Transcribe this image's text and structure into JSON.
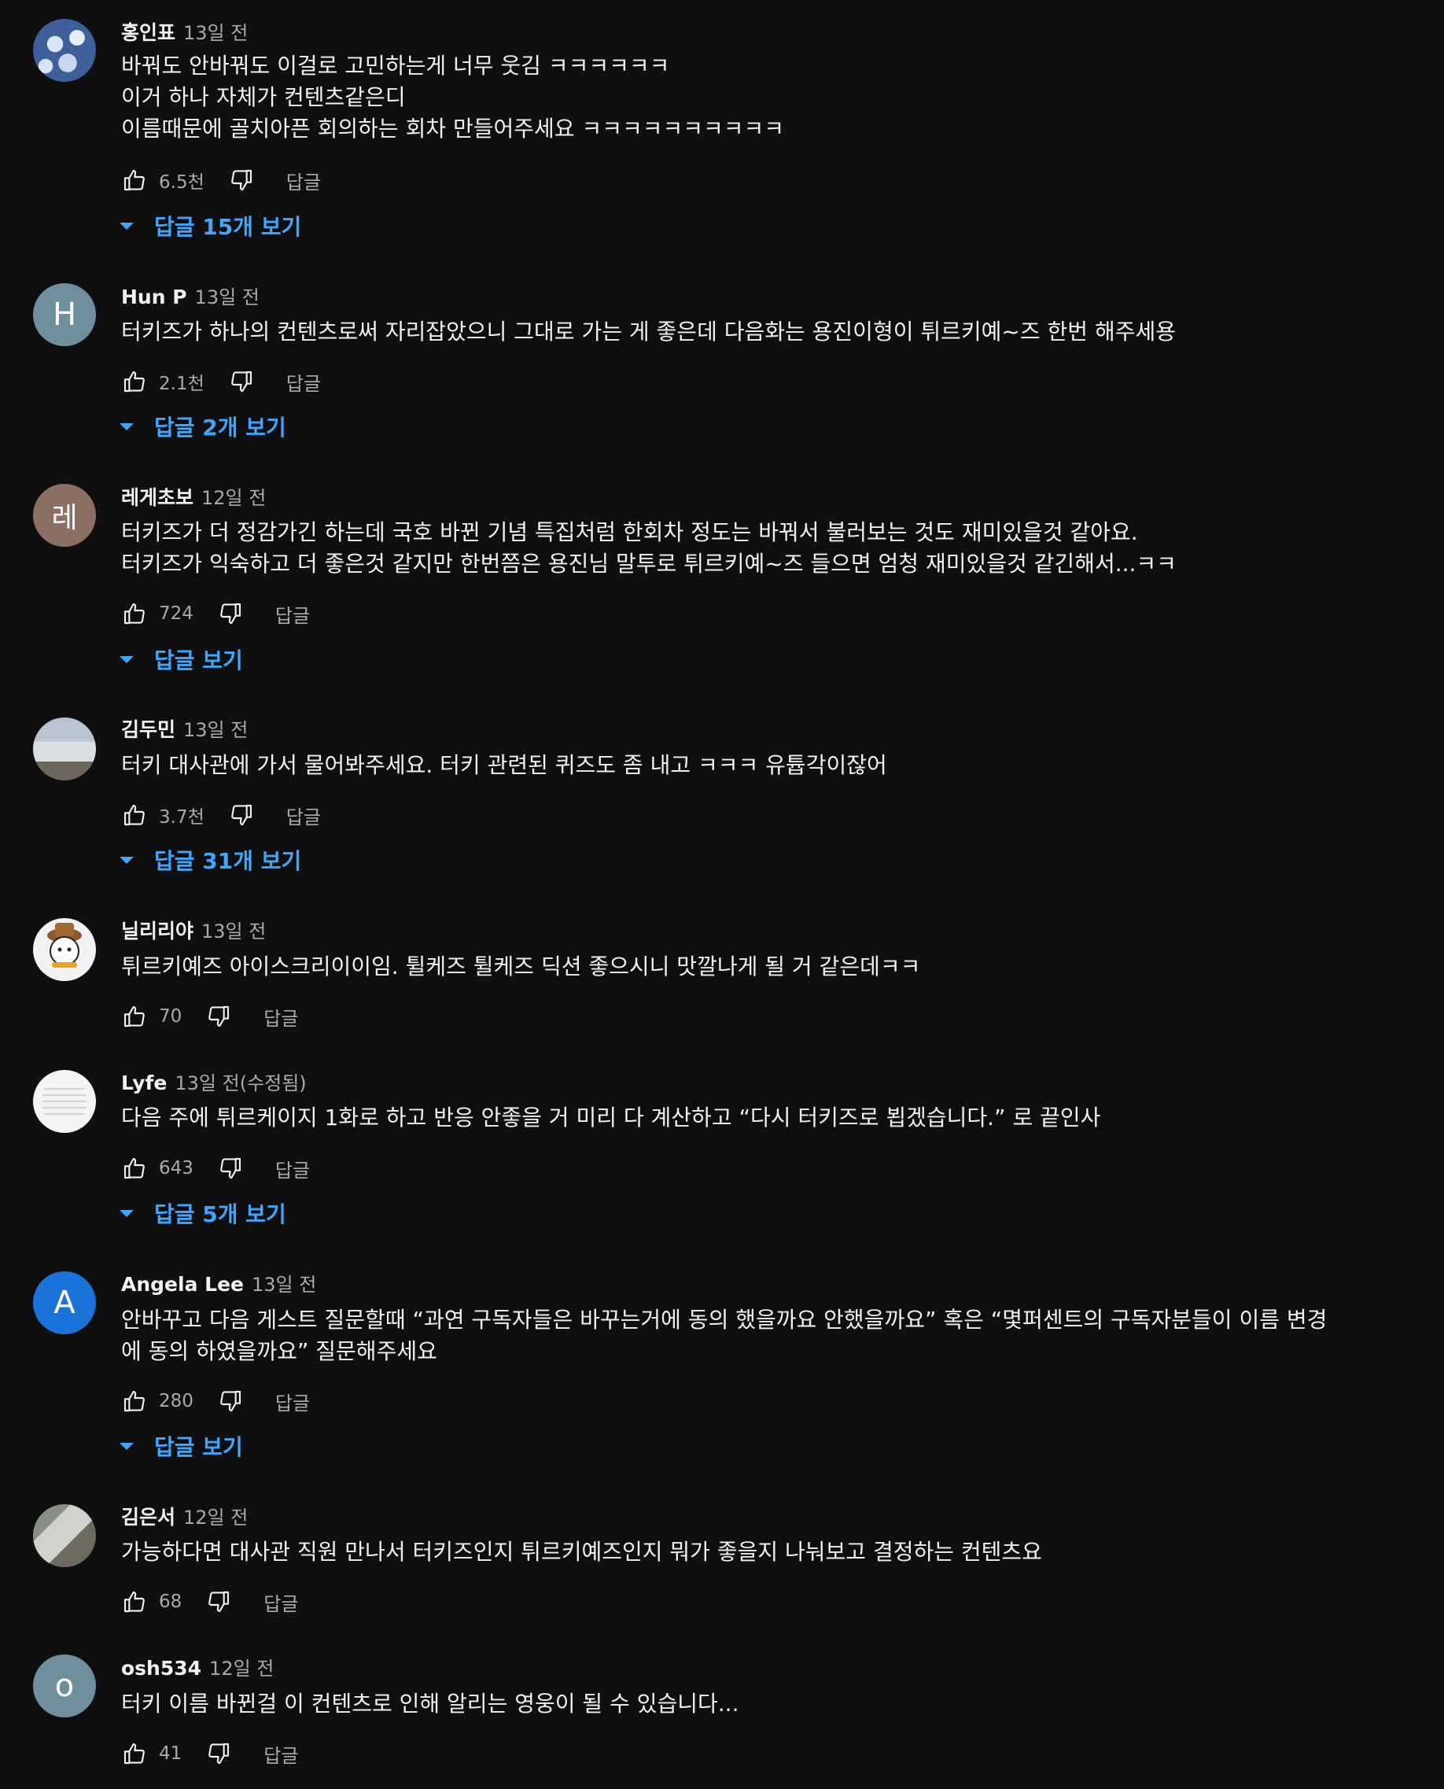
{
  "comments": [
    {
      "author": "홍인표",
      "time": "13일 전",
      "lines": [
        "바꿔도 안바꿔도 이걸로 고민하는게 너무 웃김 ㅋㅋㅋㅋㅋㅋ",
        "이거 하나 자체가 컨텐츠같은디",
        "이름때문에 골치아픈 회의하는 회차 만들어주세요 ㅋㅋㅋㅋㅋㅋㅋㅋㅋㅋ"
      ],
      "likes": "6.5천",
      "reply_label": "답글",
      "replies_label": "답글 15개 보기",
      "avatar": "sky-photo"
    },
    {
      "author": "Hun P",
      "time": "13일 전",
      "lines": [
        "터키즈가 하나의 컨텐츠로써 자리잡았으니 그대로 가는 게 좋은데 다음화는 용진이형이 튀르키예~즈 한번 해주세용"
      ],
      "likes": "2.1천",
      "reply_label": "답글",
      "replies_label": "답글 2개 보기",
      "avatar_letter": "H"
    },
    {
      "author": "레게초보",
      "time": "12일 전",
      "lines": [
        "터키즈가 더 정감가긴 하는데 국호 바뀐 기념 특집처럼 한회차 정도는 바꿔서 불러보는 것도 재미있을것 같아요.",
        "터키즈가 익숙하고 더 좋은것 같지만 한번쯤은 용진님 말투로 튀르키예~즈 들으면 엄청 재미있을것 같긴해서...ㅋㅋ"
      ],
      "likes": "724",
      "reply_label": "답글",
      "replies_label": "답글 보기",
      "avatar_letter": "레"
    },
    {
      "author": "김두민",
      "time": "13일 전",
      "lines": [
        "터키 대사관에 가서 물어봐주세요. 터키 관련된 퀴즈도 좀 내고 ㅋㅋㅋ 유튭각이잖어"
      ],
      "likes": "3.7천",
      "reply_label": "답글",
      "replies_label": "답글 31개 보기",
      "avatar": "building-photo"
    },
    {
      "author": "닐리리야",
      "time": "13일 전",
      "lines": [
        "튀르키예즈 아이스크리이이임. 튈케즈 튈케즈 딕션 좋으시니 맛깔나게 될 거 같은데ㅋㅋ"
      ],
      "likes": "70",
      "reply_label": "답글",
      "avatar": "snowman-cartoon"
    },
    {
      "author": "Lyfe",
      "time": "13일 전(수정됨)",
      "lines": [
        "다음 주에 튀르케이지 1화로 하고 반응 안좋을 거 미리 다 계산하고 “다시 터키즈로 뵙겠습니다.” 로 끝인사"
      ],
      "likes": "643",
      "reply_label": "답글",
      "replies_label": "답글 5개 보기",
      "avatar": "paper-photo"
    },
    {
      "author": "Angela Lee",
      "time": "13일 전",
      "lines": [
        "안바꾸고 다음 게스트 질문할때 “과연 구독자들은 바꾸는거에 동의 했을까요 안했을까요” 혹은 “몇퍼센트의 구독자분들이 이름 변경",
        "에 동의 하였을까요” 질문해주세요"
      ],
      "likes": "280",
      "reply_label": "답글",
      "replies_label": "답글 보기",
      "avatar_letter": "A"
    },
    {
      "author": "김은서",
      "time": "12일 전",
      "lines": [
        "가능하다면 대사관 직원 만나서 터키즈인지 튀르키예즈인지 뭐가 좋을지 나눠보고 결정하는 컨텐츠요"
      ],
      "likes": "68",
      "reply_label": "답글",
      "avatar": "room-photo"
    },
    {
      "author": "osh534",
      "time": "12일 전",
      "lines": [
        "터키 이름 바뀐걸 이 컨텐츠로 인해 알리는 영웅이 될 수 있습니다..."
      ],
      "likes": "41",
      "reply_label": "답글",
      "avatar_letter": "o"
    }
  ],
  "colors": {
    "background": "#0f0f0f",
    "text": "#f1f1f1",
    "secondary": "#aaaaaa",
    "link": "#3ea6ff"
  }
}
